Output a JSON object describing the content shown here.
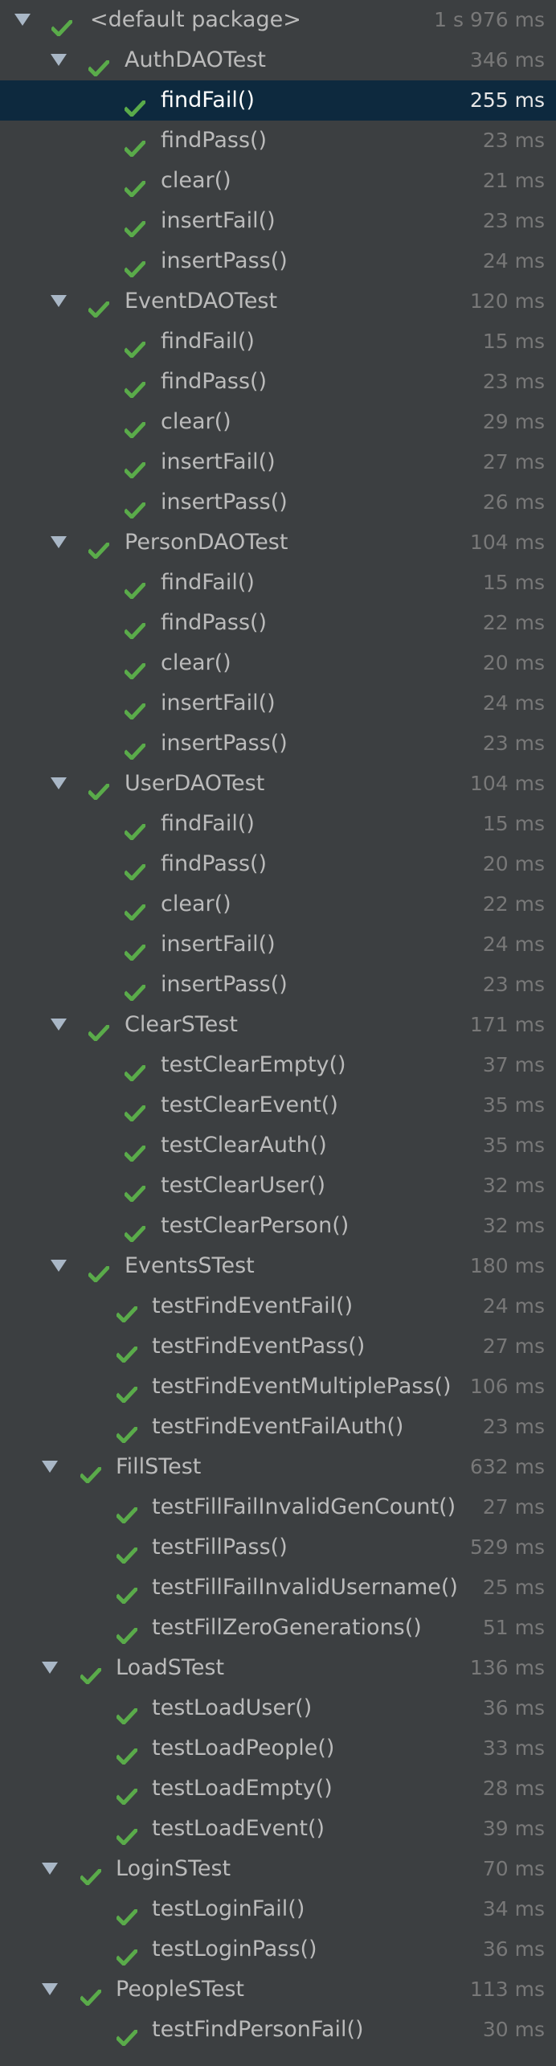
{
  "colors": {
    "background": "#3c3f41",
    "selected_row": "#0d293e",
    "pass_check": "#5aab4a",
    "text": "#bbbbbb",
    "duration": "#787878"
  },
  "icons": {
    "expand": "triangle-down-icon",
    "passed": "check-icon"
  },
  "test_tree": [
    {
      "kind": "root",
      "label": "<default package>",
      "duration": "1 s 976 ms"
    },
    {
      "kind": "suite",
      "label": "AuthDAOTest",
      "duration": "346 ms"
    },
    {
      "kind": "test",
      "label": "findFail()",
      "duration": "255 ms",
      "selected": true
    },
    {
      "kind": "test",
      "label": "findPass()",
      "duration": "23 ms"
    },
    {
      "kind": "test",
      "label": "clear()",
      "duration": "21 ms"
    },
    {
      "kind": "test",
      "label": "insertFail()",
      "duration": "23 ms"
    },
    {
      "kind": "test",
      "label": "insertPass()",
      "duration": "24 ms"
    },
    {
      "kind": "suite",
      "label": "EventDAOTest",
      "duration": "120 ms"
    },
    {
      "kind": "test",
      "label": "findFail()",
      "duration": "15 ms"
    },
    {
      "kind": "test",
      "label": "findPass()",
      "duration": "23 ms"
    },
    {
      "kind": "test",
      "label": "clear()",
      "duration": "29 ms"
    },
    {
      "kind": "test",
      "label": "insertFail()",
      "duration": "27 ms"
    },
    {
      "kind": "test",
      "label": "insertPass()",
      "duration": "26 ms"
    },
    {
      "kind": "suite",
      "label": "PersonDAOTest",
      "duration": "104 ms"
    },
    {
      "kind": "test",
      "label": "findFail()",
      "duration": "15 ms"
    },
    {
      "kind": "test",
      "label": "findPass()",
      "duration": "22 ms"
    },
    {
      "kind": "test",
      "label": "clear()",
      "duration": "20 ms"
    },
    {
      "kind": "test",
      "label": "insertFail()",
      "duration": "24 ms"
    },
    {
      "kind": "test",
      "label": "insertPass()",
      "duration": "23 ms"
    },
    {
      "kind": "suite",
      "label": "UserDAOTest",
      "duration": "104 ms"
    },
    {
      "kind": "test",
      "label": "findFail()",
      "duration": "15 ms"
    },
    {
      "kind": "test",
      "label": "findPass()",
      "duration": "20 ms"
    },
    {
      "kind": "test",
      "label": "clear()",
      "duration": "22 ms"
    },
    {
      "kind": "test",
      "label": "insertFail()",
      "duration": "24 ms"
    },
    {
      "kind": "test",
      "label": "insertPass()",
      "duration": "23 ms"
    },
    {
      "kind": "suite",
      "label": "ClearSTest",
      "duration": "171 ms"
    },
    {
      "kind": "test",
      "label": "testClearEmpty()",
      "duration": "37 ms"
    },
    {
      "kind": "test",
      "label": "testClearEvent()",
      "duration": "35 ms"
    },
    {
      "kind": "test",
      "label": "testClearAuth()",
      "duration": "35 ms"
    },
    {
      "kind": "test",
      "label": "testClearUser()",
      "duration": "32 ms"
    },
    {
      "kind": "test",
      "label": "testClearPerson()",
      "duration": "32 ms"
    },
    {
      "kind": "suite",
      "label": "EventsSTest",
      "duration": "180 ms"
    },
    {
      "kind": "test",
      "label": "testFindEventFail()",
      "duration": "24 ms"
    },
    {
      "kind": "test",
      "label": "testFindEventPass()",
      "duration": "27 ms"
    },
    {
      "kind": "test",
      "label": "testFindEventMultiplePass()",
      "duration": "106 ms"
    },
    {
      "kind": "test",
      "label": "testFindEventFailAuth()",
      "duration": "23 ms"
    },
    {
      "kind": "suite",
      "label": "FillSTest",
      "duration": "632 ms"
    },
    {
      "kind": "test",
      "label": "testFillFailInvalidGenCount()",
      "duration": "27 ms"
    },
    {
      "kind": "test",
      "label": "testFillPass()",
      "duration": "529 ms"
    },
    {
      "kind": "test",
      "label": "testFillFailInvalidUsername()",
      "duration": "25 ms"
    },
    {
      "kind": "test",
      "label": "testFillZeroGenerations()",
      "duration": "51 ms"
    },
    {
      "kind": "suite",
      "label": "LoadSTest",
      "duration": "136 ms"
    },
    {
      "kind": "test",
      "label": "testLoadUser()",
      "duration": "36 ms"
    },
    {
      "kind": "test",
      "label": "testLoadPeople()",
      "duration": "33 ms"
    },
    {
      "kind": "test",
      "label": "testLoadEmpty()",
      "duration": "28 ms"
    },
    {
      "kind": "test",
      "label": "testLoadEvent()",
      "duration": "39 ms"
    },
    {
      "kind": "suite",
      "label": "LoginSTest",
      "duration": "70 ms"
    },
    {
      "kind": "test",
      "label": "testLoginFail()",
      "duration": "34 ms"
    },
    {
      "kind": "test",
      "label": "testLoginPass()",
      "duration": "36 ms"
    },
    {
      "kind": "suite",
      "label": "PeopleSTest",
      "duration": "113 ms"
    },
    {
      "kind": "test",
      "label": "testFindPersonFail()",
      "duration": "30 ms"
    }
  ]
}
